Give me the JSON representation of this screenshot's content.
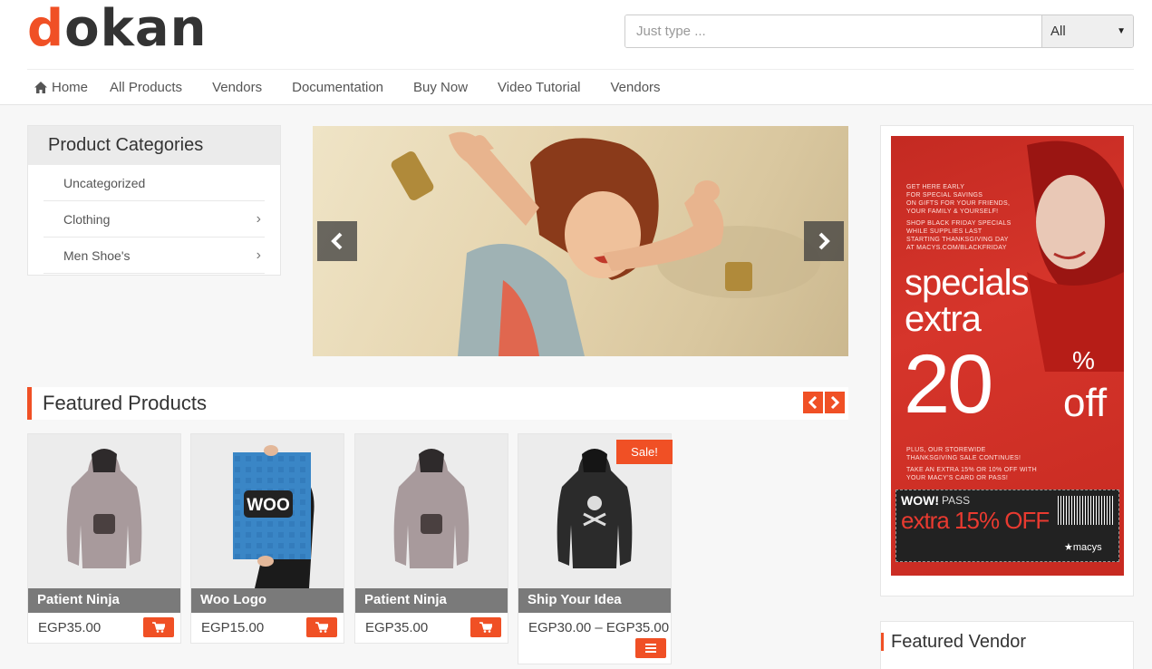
{
  "brand": {
    "logo_first": "d",
    "logo_rest": "okan",
    "accent": "#f05025"
  },
  "search": {
    "placeholder": "Just type ...",
    "value": "",
    "category": "All"
  },
  "nav": [
    {
      "label": "Home",
      "icon": "home-icon"
    },
    {
      "label": "All Products"
    },
    {
      "label": "Vendors"
    },
    {
      "label": "Documentation"
    },
    {
      "label": "Buy Now"
    },
    {
      "label": "Video Tutorial"
    },
    {
      "label": "Vendors"
    }
  ],
  "categories": {
    "title": "Product Categories",
    "items": [
      {
        "label": "Uncategorized",
        "has_children": false
      },
      {
        "label": "Clothing",
        "has_children": true
      },
      {
        "label": "Men Shoe's",
        "has_children": true
      }
    ]
  },
  "slider": {
    "prev_icon": "chevron-left-icon",
    "next_icon": "chevron-right-icon"
  },
  "featured": {
    "title": "Featured Products",
    "products": [
      {
        "title": "Patient Ninja",
        "price": "EGP35.00",
        "sale": false,
        "icon": "cart-icon"
      },
      {
        "title": "Woo Logo",
        "price": "EGP15.00",
        "sale": false,
        "icon": "cart-icon",
        "image_text": "WOO"
      },
      {
        "title": "Patient Ninja",
        "price": "EGP35.00",
        "sale": false,
        "icon": "cart-icon"
      },
      {
        "title": "Ship Your Idea",
        "price": "EGP30.00 – EGP35.00",
        "sale": true,
        "sale_label": "Sale!",
        "icon": "menu-icon"
      }
    ]
  },
  "ad": {
    "lines": [
      "GET HERE EARLY",
      "FOR SPECIAL SAVINGS",
      "ON GIFTS FOR YOUR FRIENDS,",
      "YOUR FAMILY & YOURSELF!",
      "SHOP BLACK FRIDAY SPECIALS",
      "WHILE SUPPLIES LAST",
      "STARTING THANKSGIVING DAY",
      "AT MACYS.COM/BLACKFRIDAY"
    ],
    "specials": "specials",
    "extra": "extra",
    "percent": "20",
    "pct_sign": "%",
    "off": "off",
    "sub_lines": [
      "PLUS, OUR STOREWIDE",
      "THANKSGIVING SALE CONTINUES!",
      "TAKE AN EXTRA 15% OR 10% OFF WITH",
      "YOUR MACY'S CARD OR PASS!"
    ],
    "coupon_wow": "WOW!",
    "coupon_pass": "PASS",
    "coupon_extra": "extra 15% OFF",
    "coupon_brand": "★macys"
  },
  "vendor": {
    "title": "Featured Vendor"
  }
}
